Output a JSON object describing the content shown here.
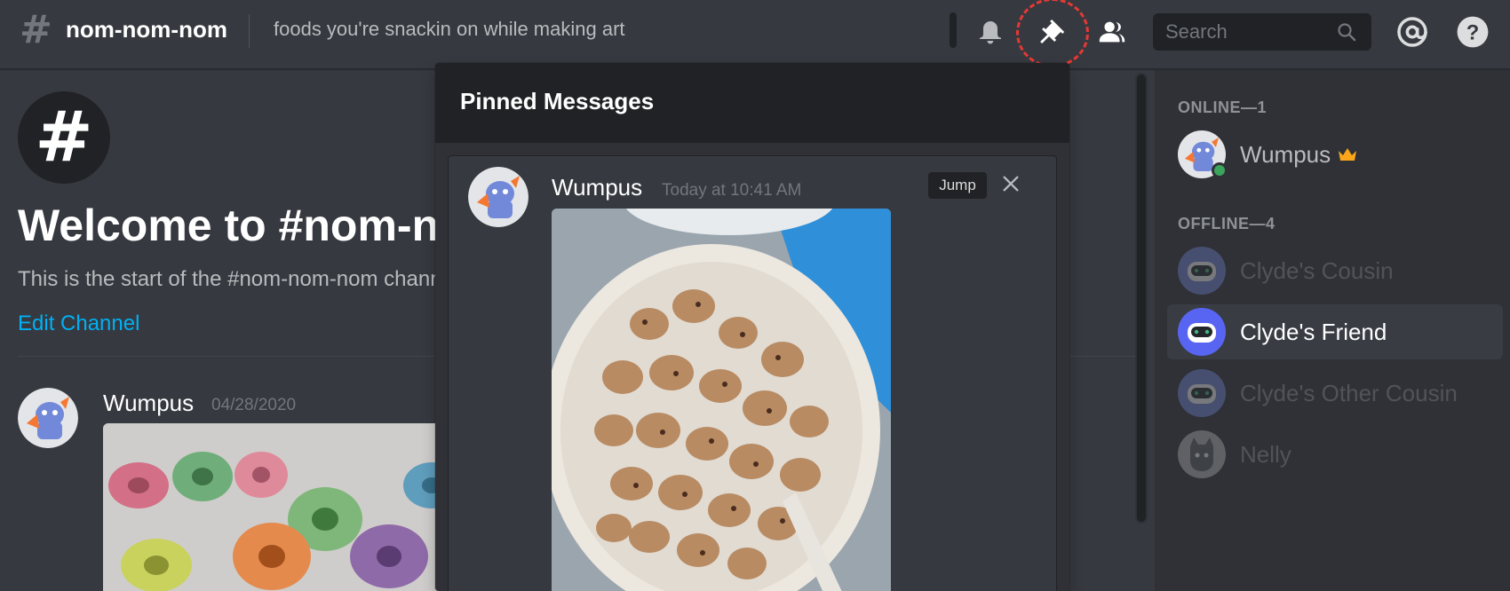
{
  "header": {
    "channel_name": "nom-nom-nom",
    "topic": "foods you're snackin on while making art",
    "search_placeholder": "Search"
  },
  "welcome": {
    "title": "Welcome to #nom-nom-nom!",
    "subtitle": "This is the start of the #nom-nom-nom channel.",
    "edit_channel": "Edit Channel"
  },
  "message": {
    "author": "Wumpus",
    "timestamp": "04/28/2020"
  },
  "pinned": {
    "title": "Pinned Messages",
    "author": "Wumpus",
    "timestamp": "Today at 10:41 AM",
    "jump_label": "Jump"
  },
  "members": {
    "online_label": "ONLINE—1",
    "offline_label": "OFFLINE—4",
    "online": [
      {
        "name": "Wumpus"
      }
    ],
    "offline": [
      {
        "name": "Clyde's Cousin"
      },
      {
        "name": "Clyde's Friend"
      },
      {
        "name": "Clyde's Other Cousin"
      },
      {
        "name": "Nelly"
      }
    ]
  },
  "colors": {
    "background": "#36393f",
    "sidebar": "#2f3136",
    "header_dark": "#202225",
    "link": "#00b0f4",
    "online_status": "#3ba55d",
    "crown": "#faa61a",
    "blurple": "#5865f2",
    "highlight_ring": "#e53935"
  }
}
